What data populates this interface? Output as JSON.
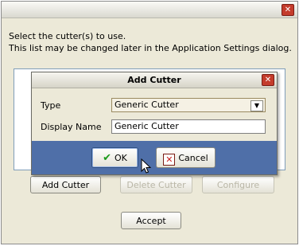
{
  "outer_dialog": {
    "close_glyph": "✕",
    "instructions": [
      "Select the cutter(s) to use.",
      "This list may be changed later in the Application Settings dialog."
    ],
    "buttons": {
      "add": "Add Cutter",
      "delete": "Delete Cutter",
      "configure": "Configure",
      "accept": "Accept"
    }
  },
  "add_cutter_dialog": {
    "title": "Add Cutter",
    "close_glyph": "✕",
    "type_label": "Type",
    "type_value": "Generic Cutter",
    "display_name_label": "Display Name",
    "display_name_value": "Generic Cutter",
    "ok_label": "OK",
    "cancel_label": "Cancel"
  },
  "colors": {
    "dialog_bg": "#ece9d8",
    "footer_bg": "#4f6fa8",
    "close_red": "#c43c2c"
  },
  "icons": [
    "close-icon",
    "checkmark-icon",
    "cancel-x-icon",
    "dropdown-arrow-icon",
    "mouse-pointer-icon"
  ]
}
